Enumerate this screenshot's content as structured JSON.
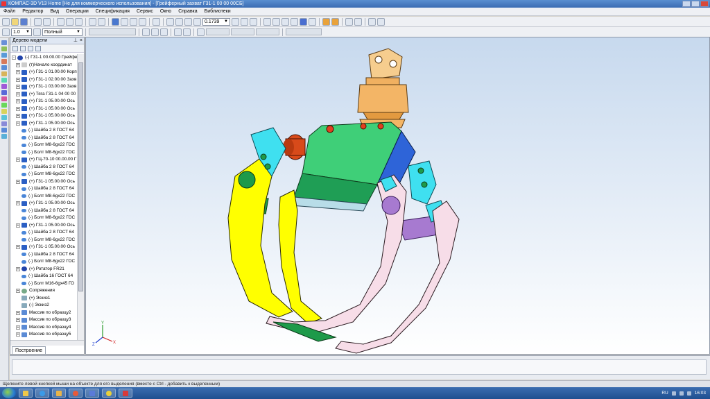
{
  "window": {
    "title": "КОМПАС-3D V13 Home [Не для коммерческого использования] - [Грейферный захват Г31-1 00 00 00СБ]"
  },
  "menu": [
    "Файл",
    "Редактор",
    "Вид",
    "Операции",
    "Спецификация",
    "Сервис",
    "Окно",
    "Справка",
    "Библиотеки"
  ],
  "toolbar": {
    "zoom_value": "0.1739",
    "line_step": "1.0",
    "view_mode": "Полный"
  },
  "tree": {
    "title": "Дерево модели",
    "items": [
      {
        "label": "(-) Г31-1 00.00.00 Грейфер",
        "icon": "assembly-icon",
        "exp": "-"
      },
      {
        "label": "(т)Начало координат",
        "icon": "origin-icon",
        "exp": "+"
      },
      {
        "label": "(+) Г31-1 01.00.00 Корп",
        "icon": "part-icon",
        "exp": "+"
      },
      {
        "label": "(+) Г31-1 02.00.00 Захв",
        "icon": "part-icon",
        "exp": "+"
      },
      {
        "label": "(+) Г31-1 03.00.00 Захв",
        "icon": "part-icon",
        "exp": "+"
      },
      {
        "label": "(+) Тяга Г31-1 04 00 00",
        "icon": "part-icon",
        "exp": "+"
      },
      {
        "label": "(+) Г31-1 05.00.00 Ось",
        "icon": "part-icon",
        "exp": "+"
      },
      {
        "label": "(+) Г31-1 05.00.00 Ось",
        "icon": "part-icon",
        "exp": "+"
      },
      {
        "label": "(+) Г31-1 05.00.00 Ось",
        "icon": "part-icon",
        "exp": "+"
      },
      {
        "label": "(+) Г31-1 05.00.00 Ось",
        "icon": "part-icon",
        "exp": "+"
      },
      {
        "label": "(-) Шайба 2 8  ГОСТ 64",
        "icon": "key-icon",
        "exp": ""
      },
      {
        "label": "(-) Шайба 2 8  ГОСТ 64",
        "icon": "key-icon",
        "exp": ""
      },
      {
        "label": "(-) Болт М8-6gx22 ГОС",
        "icon": "key-icon",
        "exp": ""
      },
      {
        "label": "(-) Болт М8-6gx22 ГОС",
        "icon": "key-icon",
        "exp": ""
      },
      {
        "label": "(+) ГЦ-70-10 00.00.00 Г",
        "icon": "part-icon",
        "exp": "+"
      },
      {
        "label": "(-) Шайба 2 8  ГОСТ 64",
        "icon": "key-icon",
        "exp": ""
      },
      {
        "label": "(-) Болт М8-6gx22 ГОС",
        "icon": "key-icon",
        "exp": ""
      },
      {
        "label": "(+) Г31-1 05.00.00 Ось",
        "icon": "part-icon",
        "exp": "+"
      },
      {
        "label": "(-) Шайба 2 8  ГОСТ 64",
        "icon": "key-icon",
        "exp": ""
      },
      {
        "label": "(-) Болт М8-6gx22 ГОС",
        "icon": "key-icon",
        "exp": ""
      },
      {
        "label": "(+) Г31-1 05.00.00 Ось",
        "icon": "part-icon",
        "exp": "+"
      },
      {
        "label": "(-) Шайба 2 8  ГОСТ 64",
        "icon": "key-icon",
        "exp": ""
      },
      {
        "label": "(-) Болт М8-6gx22 ГОС",
        "icon": "key-icon",
        "exp": ""
      },
      {
        "label": "(+) Г31-1 05.00.00 Ось",
        "icon": "part-icon",
        "exp": "+"
      },
      {
        "label": "(-) Шайба 2 8  ГОСТ 64",
        "icon": "key-icon",
        "exp": ""
      },
      {
        "label": "(-) Болт М8-6gx22 ГОС",
        "icon": "key-icon",
        "exp": ""
      },
      {
        "label": "(+) Г31-1 05.00.00 Ось",
        "icon": "part-icon",
        "exp": "+"
      },
      {
        "label": "(-) Шайба 2 8  ГОСТ 64",
        "icon": "key-icon",
        "exp": ""
      },
      {
        "label": "(-) Болт М8-6gx22 ГОС",
        "icon": "key-icon",
        "exp": ""
      },
      {
        "label": "(+) Ротатор FR21",
        "icon": "assembly-icon",
        "exp": "+"
      },
      {
        "label": "(-) Шайба 16  ГОСТ 64",
        "icon": "key-icon",
        "exp": ""
      },
      {
        "label": "(-) Болт М16-6gx45 ГО",
        "icon": "key-icon",
        "exp": ""
      },
      {
        "label": "Сопряжения",
        "icon": "mate-icon",
        "exp": "+"
      },
      {
        "label": "(+) Эскиз1",
        "icon": "sketch-icon",
        "exp": ""
      },
      {
        "label": "(-) Эскиз2",
        "icon": "sketch-icon",
        "exp": ""
      },
      {
        "label": "Массив по образцу2",
        "icon": "array-icon",
        "exp": "+"
      },
      {
        "label": "Массив по образцу3",
        "icon": "array-icon",
        "exp": "+"
      },
      {
        "label": "Массив по образцу4",
        "icon": "array-icon",
        "exp": "+"
      },
      {
        "label": "Массив по образцу5",
        "icon": "array-icon",
        "exp": "+"
      }
    ],
    "tab": "Построение"
  },
  "statusbar": {
    "hint": "Щелкните левой кнопкой мыши на объекте для его выделения (вместе с Ctrl - добавить к выделенным)"
  },
  "taskbar": {
    "lang": "RU",
    "time": "16:03"
  },
  "colors": {
    "body_green": "#3fcf78",
    "jaw_yellow": "#ffff00",
    "jaw_pink": "#f7dde8",
    "rotator_orange": "#f3b566",
    "cyan_link": "#3fe0f0",
    "purple_axle": "#a77ad0"
  }
}
